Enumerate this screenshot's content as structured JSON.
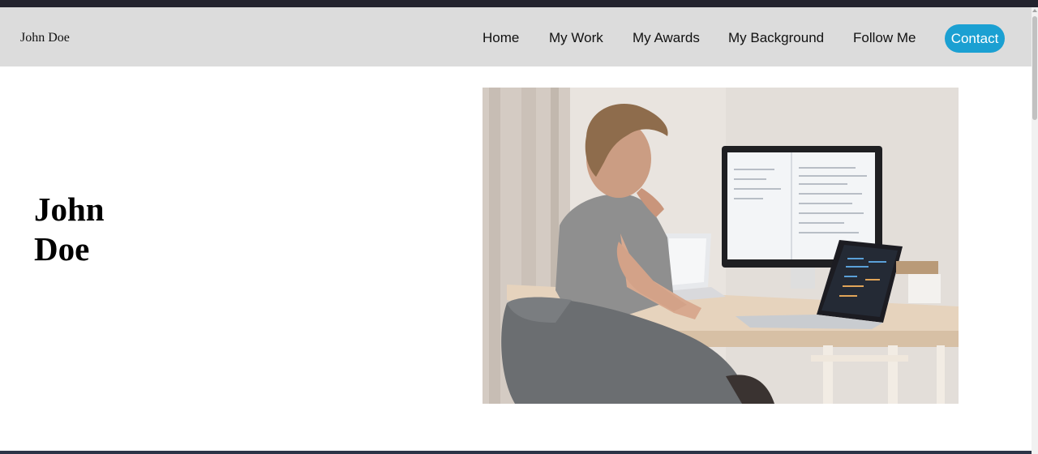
{
  "header": {
    "brand": "John Doe",
    "nav": [
      {
        "label": "Home"
      },
      {
        "label": "My Work"
      },
      {
        "label": "My Awards"
      },
      {
        "label": "My Background"
      },
      {
        "label": "Follow Me"
      }
    ],
    "contact_label": "Contact"
  },
  "hero": {
    "title_line1": "John",
    "title_line2": "Doe"
  },
  "photo": {
    "subject": "person-at-desk-with-computers"
  },
  "colors": {
    "navbar_bg": "#dcdcdc",
    "contact_bg": "#1ba0d2",
    "contact_text": "#ffffff"
  }
}
